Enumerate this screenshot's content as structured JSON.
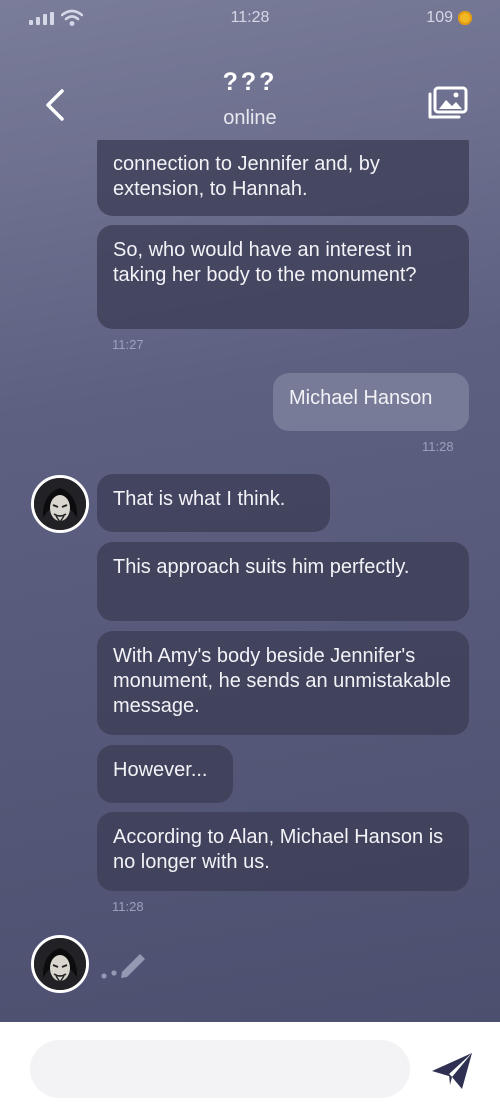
{
  "status": {
    "time": "11:28",
    "coins": "109"
  },
  "header": {
    "title": "???",
    "subtitle": "online"
  },
  "messages": [
    {
      "text": "connection to Jennifer and, by extension, to Hannah."
    },
    {
      "text": "So, who would have an interest in taking her body to the monument?"
    },
    {
      "time": "11:27"
    },
    {
      "text": "Michael Hanson"
    },
    {
      "time": "11:28"
    },
    {
      "text": "That is what I think."
    },
    {
      "text": "This approach suits him perfectly."
    },
    {
      "text": "With Amy's body beside Jennifer's monument, he sends an unmistakable message."
    },
    {
      "text": "However..."
    },
    {
      "text": "According to Alan, Michael Hanson is no longer with us."
    },
    {
      "time": "11:28"
    }
  ],
  "composer": {
    "placeholder": ""
  },
  "colors": {
    "accent": "#2f3052",
    "coin": "#f2b823"
  }
}
